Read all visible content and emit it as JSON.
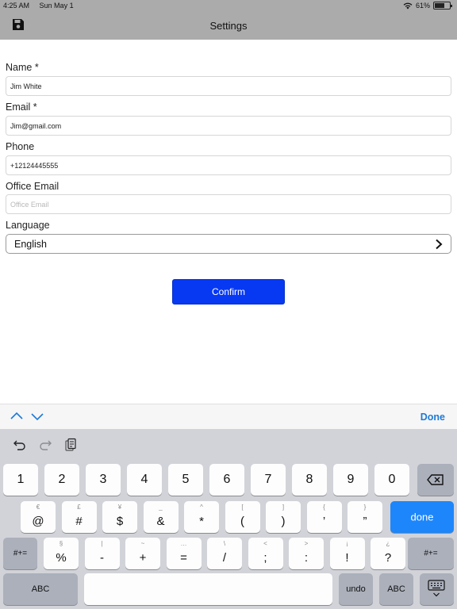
{
  "status_bar": {
    "time": "4:25 AM",
    "date": "Sun May 1",
    "battery": "61%",
    "battery_level": 0.61
  },
  "nav": {
    "title": "Settings",
    "save_icon": "save-icon"
  },
  "form": {
    "name": {
      "label": "Name *",
      "value": "Jim White"
    },
    "email": {
      "label": "Email *",
      "value": "Jim@gmail.com"
    },
    "phone": {
      "label": "Phone",
      "value": "+12124445555"
    },
    "office_email": {
      "label": "Office Email",
      "placeholder": "Office Email"
    },
    "language": {
      "label": "Language",
      "value": "English"
    },
    "confirm_label": "Confirm"
  },
  "accessory": {
    "done_label": "Done"
  },
  "keyboard": {
    "row1": [
      "1",
      "2",
      "3",
      "4",
      "5",
      "6",
      "7",
      "8",
      "9",
      "0"
    ],
    "row2": [
      {
        "main": "@",
        "alt": "€"
      },
      {
        "main": "#",
        "alt": "£"
      },
      {
        "main": "$",
        "alt": "¥"
      },
      {
        "main": "&",
        "alt": "_"
      },
      {
        "main": "*",
        "alt": "^"
      },
      {
        "main": "(",
        "alt": "["
      },
      {
        "main": ")",
        "alt": "]"
      },
      {
        "main": "’",
        "alt": "{"
      },
      {
        "main": "”",
        "alt": "}"
      }
    ],
    "done_key": "done",
    "row3": [
      {
        "main": "%",
        "alt": "§"
      },
      {
        "main": "-",
        "alt": "|"
      },
      {
        "main": "+",
        "alt": "~"
      },
      {
        "main": "=",
        "alt": "…"
      },
      {
        "main": "/",
        "alt": "\\"
      },
      {
        "main": ";",
        "alt": "<"
      },
      {
        "main": ":",
        "alt": ">"
      },
      {
        "main": "!",
        "alt": "¡"
      },
      {
        "main": "?",
        "alt": "¿"
      }
    ],
    "shift_label": "#+=",
    "abc_label": "ABC",
    "undo_label": "undo"
  },
  "colors": {
    "accent": "#1e7ad8",
    "confirm": "#0739f3",
    "done_key": "#1d86fa"
  }
}
